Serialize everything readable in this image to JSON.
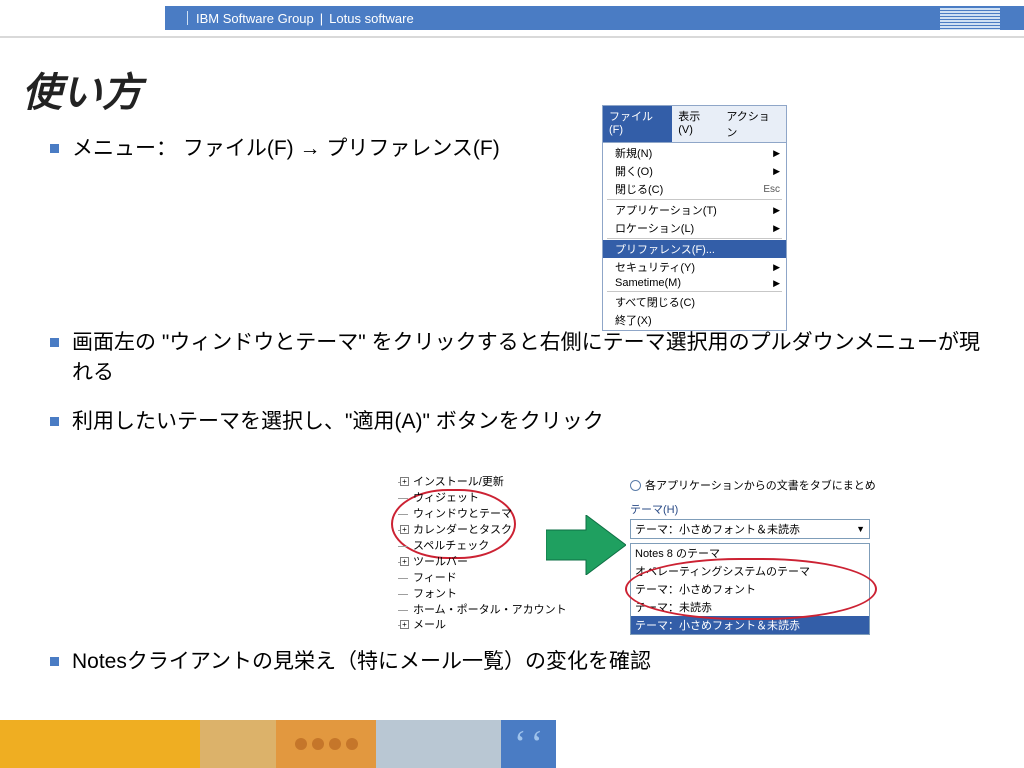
{
  "header": {
    "group": "IBM Software Group",
    "product": "Lotus software",
    "logo_alt": "IBM"
  },
  "title": "使い方",
  "bullets": [
    "メニュー：  ファイル(F)  →  プリファレンス(F)",
    "画面左の \"ウィンドウとテーマ\" をクリックすると右側にテーマ選択用のプルダウンメニューが現れる",
    "利用したいテーマを選択し、\"適用(A)\" ボタンをクリック",
    "Notesクライアントの見栄え（特にメール一覧）の変化を確認"
  ],
  "file_menu": {
    "tabs": [
      "ファイル(F)",
      "表示(V)",
      "アクション"
    ],
    "items": [
      {
        "label": "新規(N)",
        "arrow": true
      },
      {
        "label": "開く(O)",
        "arrow": true
      },
      {
        "label": "閉じる(C)",
        "shortcut": "Esc"
      },
      {
        "sep": true
      },
      {
        "label": "アプリケーション(T)",
        "arrow": true
      },
      {
        "label": "ロケーション(L)",
        "arrow": true
      },
      {
        "sep": true
      },
      {
        "label": "プリファレンス(F)...",
        "selected": true
      },
      {
        "label": "セキュリティ(Y)",
        "arrow": true
      },
      {
        "label": "Sametime(M)",
        "arrow": true
      },
      {
        "sep": true
      },
      {
        "label": "すべて閉じる(C)"
      },
      {
        "label": "終了(X)"
      }
    ]
  },
  "pref_tree": [
    {
      "expand": "+",
      "label": "インストール/更新"
    },
    {
      "expand": "",
      "label": "ウィジェット"
    },
    {
      "expand": "",
      "label": "ウィンドウとテーマ"
    },
    {
      "expand": "+",
      "label": "カレンダーとタスク"
    },
    {
      "expand": "",
      "label": "スペルチェック"
    },
    {
      "expand": "+",
      "label": "ツールバー"
    },
    {
      "expand": "",
      "label": "フィード"
    },
    {
      "expand": "",
      "label": "フォント"
    },
    {
      "expand": "",
      "label": "ホーム・ポータル・アカウント"
    },
    {
      "expand": "+",
      "label": "メール"
    }
  ],
  "theme_panel": {
    "radio_label": "各アプリケーションからの文書をタブにまとめ",
    "section_label": "テーマ(H)",
    "combo_value": "テーマ：小さめフォント＆未読赤",
    "options": [
      "Notes 8 のテーマ",
      "オペレーティングシステムのテーマ",
      "テーマ：小さめフォント",
      "テーマ：未読赤",
      "テーマ：小さめフォント＆未読赤"
    ],
    "selected_index": 4
  }
}
